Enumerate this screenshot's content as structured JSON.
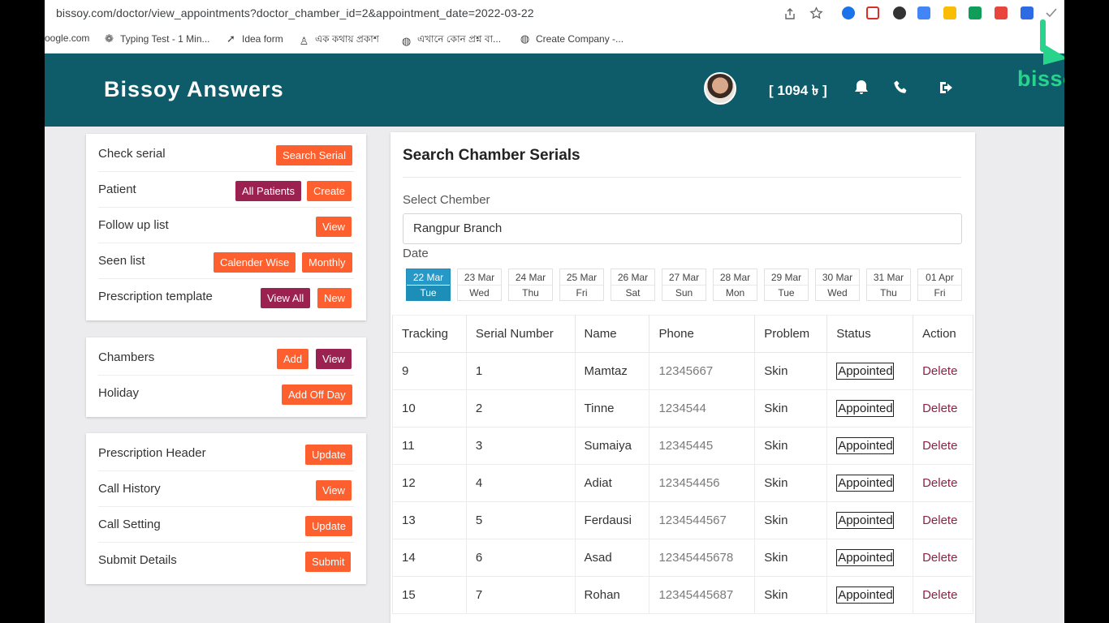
{
  "browser": {
    "url": "bissoy.com/doctor/view_appointments?doctor_chamber_id=2&appointment_date=2022-03-22",
    "bookmarks": [
      {
        "label": "oogle.com",
        "icon": "globe-icon"
      },
      {
        "label": "Typing Test - 1 Min...",
        "icon": "paw-icon"
      },
      {
        "label": "Idea form",
        "icon": "rocket-icon"
      },
      {
        "label": "এক কথায় প্রকাশ",
        "icon": "person-icon"
      },
      {
        "label": "এখানে কোন প্রশ্ন বা...",
        "icon": "globe-icon"
      },
      {
        "label": "Create Company -...",
        "icon": "globe-icon"
      }
    ]
  },
  "header": {
    "title": "Bissoy Answers",
    "balance": "[ 1094 ৳ ]",
    "icons": [
      "bell-icon",
      "phone-icon",
      "logout-icon"
    ]
  },
  "watermark": {
    "text": "bissoy"
  },
  "sidebar": {
    "card1": [
      {
        "label": "Check serial",
        "buttons": [
          {
            "label": "Search Serial",
            "color": "#fd5f2e"
          }
        ]
      },
      {
        "label": "Patient",
        "buttons": [
          {
            "label": "All Patients",
            "color": "#9a2150"
          },
          {
            "label": "Create",
            "color": "#fd5f2e"
          }
        ]
      },
      {
        "label": "Follow up list",
        "buttons": [
          {
            "label": "View",
            "color": "#fd5f2e"
          }
        ]
      },
      {
        "label": "Seen list",
        "buttons": [
          {
            "label": "Calender Wise",
            "color": "#fd5f2e"
          },
          {
            "label": "Monthly",
            "color": "#fd5f2e"
          }
        ]
      },
      {
        "label": "Prescription template",
        "buttons": [
          {
            "label": "View All",
            "color": "#9a2150"
          },
          {
            "label": "New",
            "color": "#fd5f2e"
          }
        ]
      }
    ],
    "card2": [
      {
        "label": "Chambers",
        "buttons": [
          {
            "label": "Add",
            "color": "#fd5f2e"
          },
          {
            "label": "View",
            "color": "#9a2150"
          }
        ]
      },
      {
        "label": "Holiday",
        "buttons": [
          {
            "label": "Add Off Day",
            "color": "#fd5f2e"
          }
        ]
      }
    ],
    "card3": [
      {
        "label": "Prescription Header",
        "buttons": [
          {
            "label": "Update",
            "color": "#fd5f2e"
          }
        ]
      },
      {
        "label": "Call History",
        "buttons": [
          {
            "label": "View",
            "color": "#fd5f2e"
          }
        ]
      },
      {
        "label": "Call Setting",
        "buttons": [
          {
            "label": "Update",
            "color": "#fd5f2e"
          }
        ]
      },
      {
        "label": "Submit Details",
        "buttons": [
          {
            "label": "Submit",
            "color": "#fd5f2e"
          }
        ]
      }
    ]
  },
  "main": {
    "title": "Search Chamber Serials",
    "chamber_label": "Select Chember",
    "chamber_value": "Rangpur Branch",
    "date_label": "Date",
    "dates": [
      {
        "date": "22 Mar",
        "day": "Tue",
        "active": true
      },
      {
        "date": "23 Mar",
        "day": "Wed"
      },
      {
        "date": "24 Mar",
        "day": "Thu"
      },
      {
        "date": "25 Mar",
        "day": "Fri"
      },
      {
        "date": "26 Mar",
        "day": "Sat"
      },
      {
        "date": "27 Mar",
        "day": "Sun"
      },
      {
        "date": "28 Mar",
        "day": "Mon"
      },
      {
        "date": "29 Mar",
        "day": "Tue"
      },
      {
        "date": "30 Mar",
        "day": "Wed"
      },
      {
        "date": "31 Mar",
        "day": "Thu"
      },
      {
        "date": "01 Apr",
        "day": "Fri"
      }
    ],
    "table": {
      "columns": [
        "Tracking",
        "Serial Number",
        "Name",
        "Phone",
        "Problem",
        "Status",
        "Action"
      ],
      "rows": [
        {
          "tracking": "9",
          "serial": "1",
          "name": "Mamtaz",
          "phone": "12345667",
          "problem": "Skin",
          "status": "Appointed",
          "action": "Delete"
        },
        {
          "tracking": "10",
          "serial": "2",
          "name": "Tinne",
          "phone": "1234544",
          "problem": "Skin",
          "status": "Appointed",
          "action": "Delete"
        },
        {
          "tracking": "11",
          "serial": "3",
          "name": "Sumaiya",
          "phone": "12345445",
          "problem": "Skin",
          "status": "Appointed",
          "action": "Delete"
        },
        {
          "tracking": "12",
          "serial": "4",
          "name": "Adiat",
          "phone": "123454456",
          "problem": "Skin",
          "status": "Appointed",
          "action": "Delete"
        },
        {
          "tracking": "13",
          "serial": "5",
          "name": "Ferdausi",
          "phone": "1234544567",
          "problem": "Skin",
          "status": "Appointed",
          "action": "Delete"
        },
        {
          "tracking": "14",
          "serial": "6",
          "name": "Asad",
          "phone": "12345445678",
          "problem": "Skin",
          "status": "Appointed",
          "action": "Delete"
        },
        {
          "tracking": "15",
          "serial": "7",
          "name": "Rohan",
          "phone": "12345445687",
          "problem": "Skin",
          "status": "Appointed",
          "action": "Delete"
        }
      ]
    }
  },
  "colors": {
    "header_bg": "#0e5b69",
    "btn_orange": "#fd5f2e",
    "btn_maroon": "#9a2150",
    "active_date": "#1c8eb7",
    "delete": "#8a2347"
  }
}
